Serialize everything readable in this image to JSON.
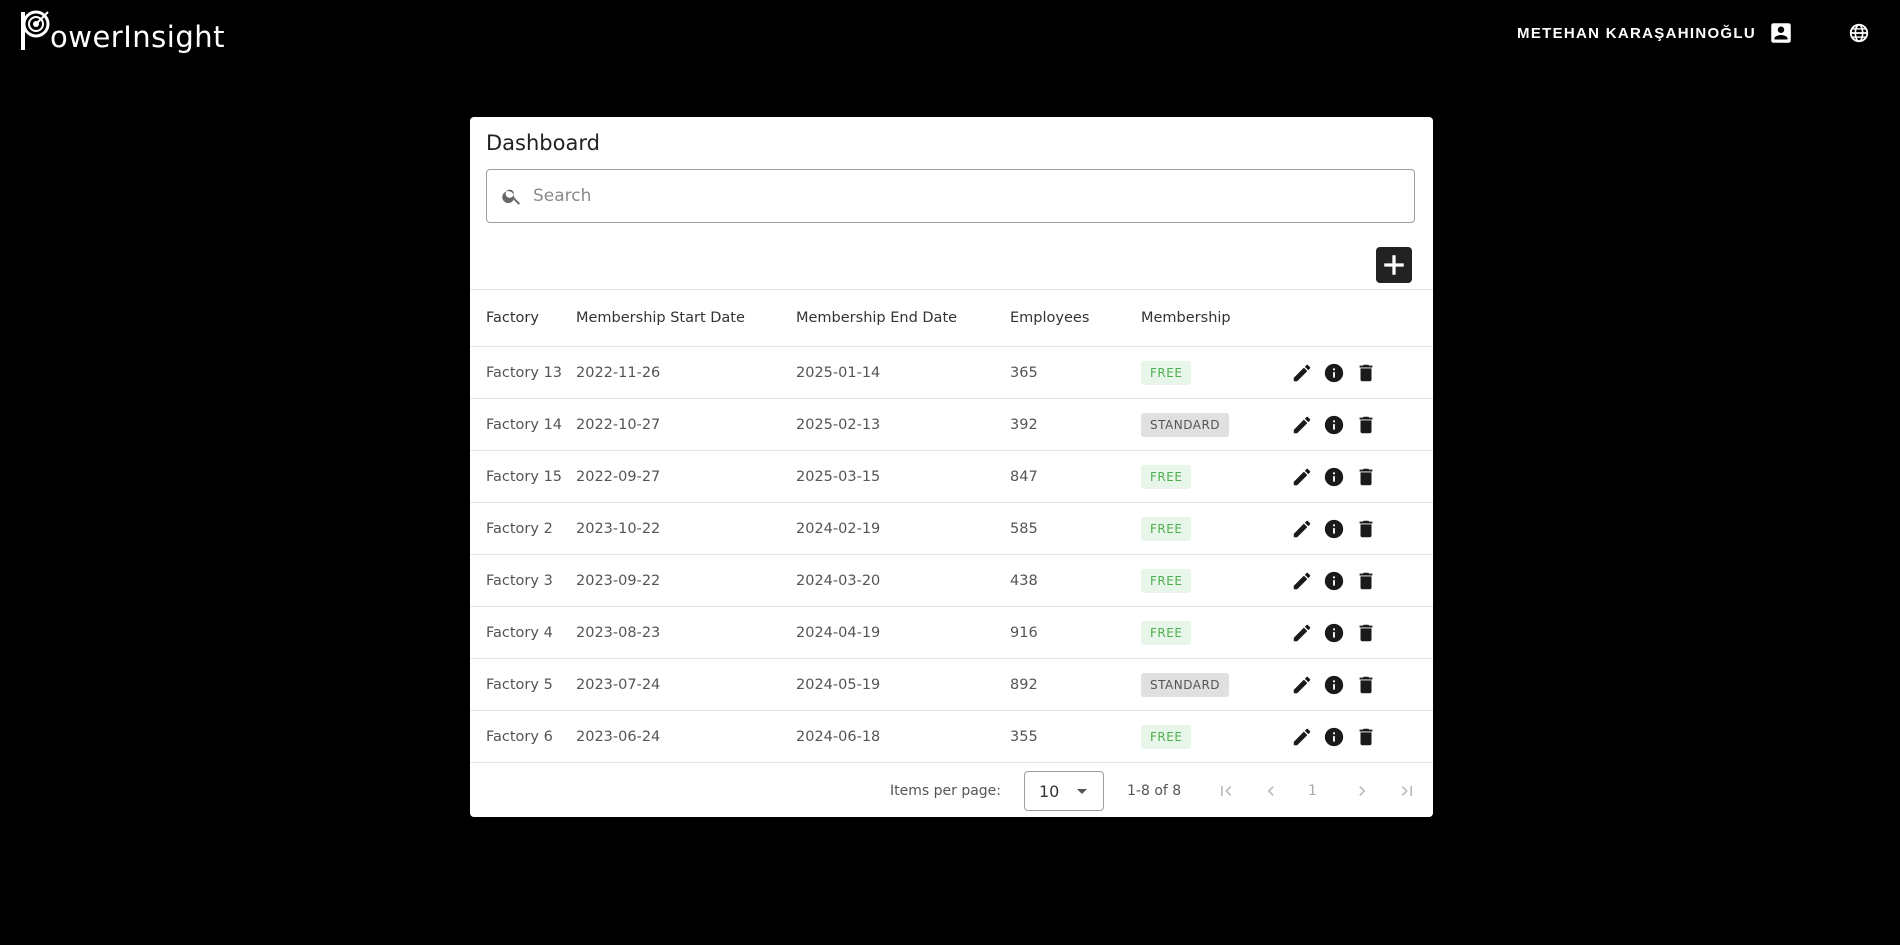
{
  "header": {
    "logo_text": "owerInsight",
    "logo_mark": "P",
    "user_name": "METEHAN KARAŞAHINOĞLU",
    "user_icon": "account-box-icon",
    "language_icon": "globe-icon"
  },
  "dashboard": {
    "title": "Dashboard",
    "search_placeholder": "Search",
    "add_icon": "plus-icon"
  },
  "table": {
    "columns": [
      "Factory",
      "Membership Start Date",
      "Membership End Date",
      "Employees",
      "Membership",
      ""
    ],
    "rows": [
      {
        "factory": "Factory 13",
        "start": "2022-11-26",
        "end": "2025-01-14",
        "employees": "365",
        "membership": "FREE"
      },
      {
        "factory": "Factory 14",
        "start": "2022-10-27",
        "end": "2025-02-13",
        "employees": "392",
        "membership": "STANDARD"
      },
      {
        "factory": "Factory 15",
        "start": "2022-09-27",
        "end": "2025-03-15",
        "employees": "847",
        "membership": "FREE"
      },
      {
        "factory": "Factory 2",
        "start": "2023-10-22",
        "end": "2024-02-19",
        "employees": "585",
        "membership": "FREE"
      },
      {
        "factory": "Factory 3",
        "start": "2023-09-22",
        "end": "2024-03-20",
        "employees": "438",
        "membership": "FREE"
      },
      {
        "factory": "Factory 4",
        "start": "2023-08-23",
        "end": "2024-04-19",
        "employees": "916",
        "membership": "FREE"
      },
      {
        "factory": "Factory 5",
        "start": "2023-07-24",
        "end": "2024-05-19",
        "employees": "892",
        "membership": "STANDARD"
      },
      {
        "factory": "Factory 6",
        "start": "2023-06-24",
        "end": "2024-06-18",
        "employees": "355",
        "membership": "FREE"
      }
    ],
    "row_actions": [
      "edit-icon",
      "info-icon",
      "delete-icon"
    ]
  },
  "paginator": {
    "items_per_page_label": "Items per page:",
    "items_per_page_value": "10",
    "range_label": "1-8 of 8",
    "current_page": "1"
  },
  "colors": {
    "background": "#000000",
    "card": "#ffffff",
    "free_badge_text": "#4caf50",
    "free_badge_bg": "#e8f6e9",
    "standard_badge_bg": "#e0e0e0"
  }
}
